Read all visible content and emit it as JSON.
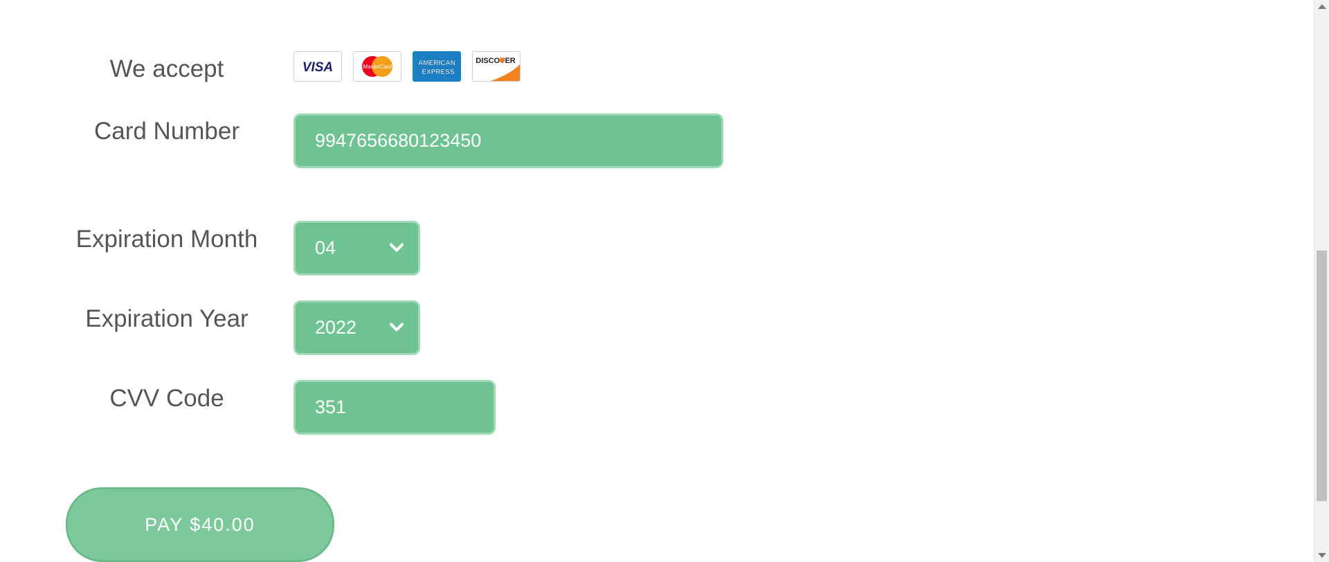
{
  "accept": {
    "label": "We accept",
    "cards": [
      {
        "name": "visa",
        "text": "VISA"
      },
      {
        "name": "mastercard",
        "text": "MasterCard"
      },
      {
        "name": "american-express",
        "text_line1": "AMERICAN",
        "text_line2": "EXPRESS"
      },
      {
        "name": "discover",
        "text": "DISCOVER"
      }
    ]
  },
  "card_number": {
    "label": "Card Number",
    "value": "9947656680123450"
  },
  "expiration_month": {
    "label": "Expiration Month",
    "value": "04"
  },
  "expiration_year": {
    "label": "Expiration Year",
    "value": "2022"
  },
  "cvv": {
    "label": "CVV Code",
    "value": "351"
  },
  "pay_button": {
    "label": "PAY $40.00"
  },
  "colors": {
    "field_bg": "#6fc292",
    "field_border": "#9fd9b6",
    "button_bg": "#7ec99c",
    "label_text": "#555555"
  },
  "icons": {
    "select_arrow": "chevron-down-icon"
  }
}
